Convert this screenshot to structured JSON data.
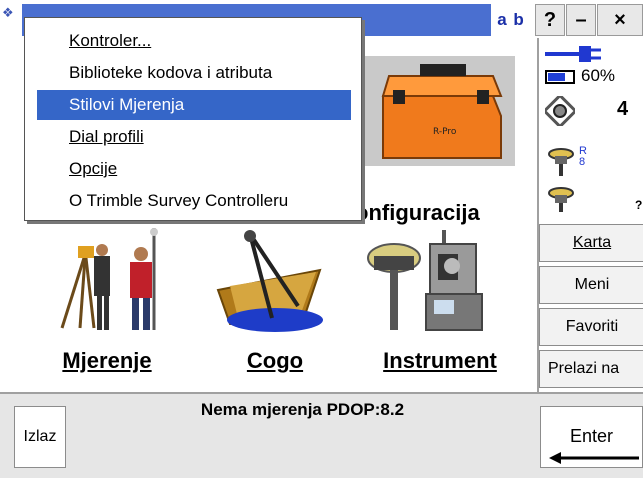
{
  "titlebar": {
    "ab_label": "a b",
    "help_label": "?",
    "minimize_label": "–",
    "close_label": "×"
  },
  "menu": {
    "items": [
      {
        "label": "Kontroler...",
        "selected": false
      },
      {
        "label": "Biblioteke kodova i atributa",
        "selected": false
      },
      {
        "label": "Stilovi Mjerenja",
        "selected": true
      },
      {
        "label": "Dial profili",
        "selected": false
      },
      {
        "label": "Opcije",
        "selected": false
      },
      {
        "label": "O Trimble Survey Controlleru",
        "selected": false
      }
    ]
  },
  "main": {
    "tiles": [
      {
        "label": "onfiguracija"
      },
      {
        "label": "Mjerenje"
      },
      {
        "label": "Cogo"
      },
      {
        "label": "Instrument"
      }
    ]
  },
  "status_panel": {
    "battery_percent": "60%",
    "satellite_count": "4",
    "receiver_badge": "R\n8",
    "unknown_mark": "?"
  },
  "side_buttons": [
    {
      "label": "Karta"
    },
    {
      "label": "Meni"
    },
    {
      "label": "Favoriti"
    },
    {
      "label": "Prelazi na"
    }
  ],
  "bottom": {
    "status": "Nema mjerenja  PDOP:8.2",
    "exit_label": "Izlaz",
    "enter_label": "Enter"
  }
}
